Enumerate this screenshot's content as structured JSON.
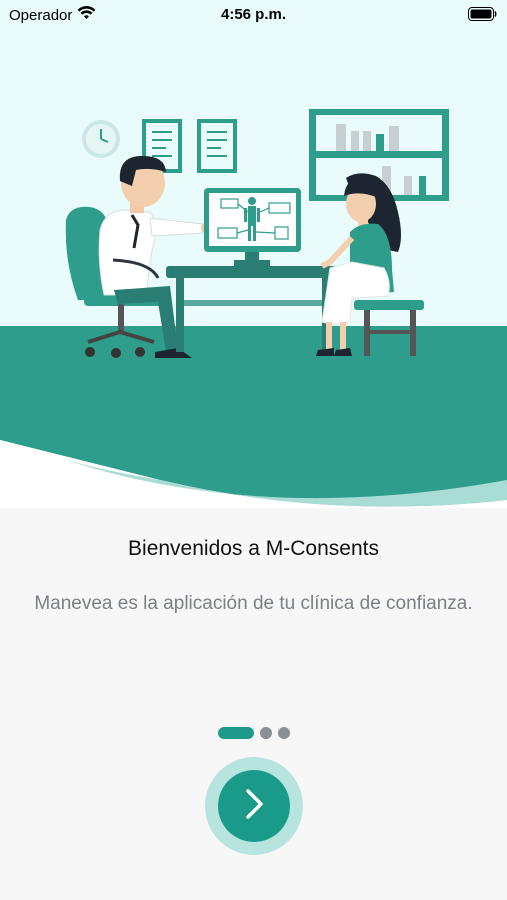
{
  "status_bar": {
    "carrier": "Operador",
    "time": "4:56 p.m."
  },
  "onboarding": {
    "title": "Bienvenidos a M-Consents",
    "subtitle": "Manevea es la aplicación de tu clínica de confianza.",
    "pages_total": 3,
    "current_page": 1,
    "next_icon": "chevron-right-icon"
  },
  "colors": {
    "accent": "#1a9b8a",
    "accent_light": "#b7e4df",
    "hero_background": "#e9fbfa"
  }
}
